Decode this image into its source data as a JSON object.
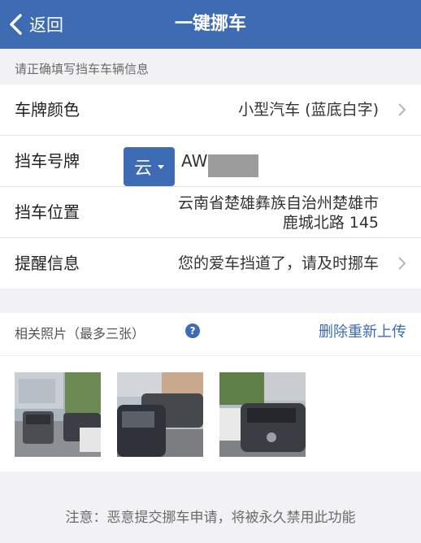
{
  "nav": {
    "back_label": "返回",
    "title": "一键挪车"
  },
  "form_hint": "请正确填写挡车车辆信息",
  "form": {
    "plate_color": {
      "label": "车牌颜色",
      "value": "小型汽车 (蓝底白字)"
    },
    "plate_number": {
      "label": "挡车号牌",
      "province": "云",
      "prefix": "AW"
    },
    "location": {
      "label": "挡车位置",
      "line1": "云南省楚雄彝族自治州楚雄市",
      "line2": "鹿城北路 145"
    },
    "reminder": {
      "label": "提醒信息",
      "value": "您的爱车挡道了，请及时挪车"
    }
  },
  "photos": {
    "label": "相关照片（最多三张）",
    "help": "?",
    "reupload": "删除重新上传",
    "count": 3
  },
  "footer_note": "注意：恶意提交挪车申请，将被永久禁用此功能",
  "colors": {
    "brand": "#3d6bb4"
  }
}
